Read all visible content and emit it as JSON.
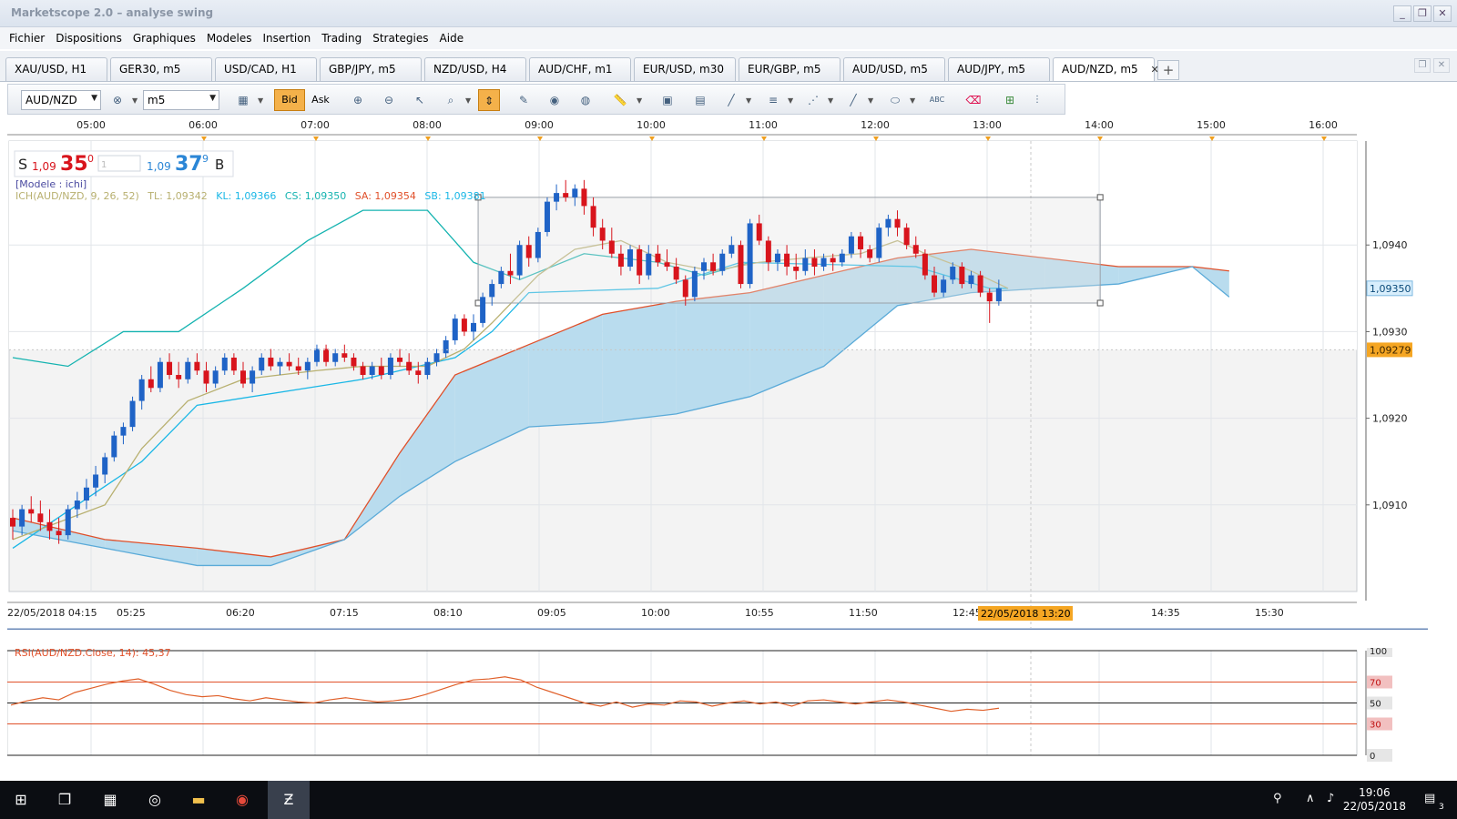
{
  "window": {
    "title": "Marketscope 2.0 – analyse swing",
    "btn_min": "_",
    "btn_max": "❐",
    "btn_close": "✕"
  },
  "menu": [
    "Fichier",
    "Dispositions",
    "Graphiques",
    "Modeles",
    "Insertion",
    "Trading",
    "Strategies",
    "Aide"
  ],
  "tabs": [
    {
      "label": "XAU/USD, H1"
    },
    {
      "label": "GER30, m5"
    },
    {
      "label": "USD/CAD, H1"
    },
    {
      "label": "GBP/JPY, m5"
    },
    {
      "label": "NZD/USD, H4"
    },
    {
      "label": "AUD/CHF, m1"
    },
    {
      "label": "EUR/USD, m30"
    },
    {
      "label": "EUR/GBP, m5"
    },
    {
      "label": "AUD/USD, m5"
    },
    {
      "label": "AUD/JPY, m5"
    },
    {
      "label": "AUD/NZD, m5",
      "active": true
    }
  ],
  "tab_close": "✕",
  "tab_add": "+",
  "toolbar": {
    "instrument": "AUD/NZD",
    "timeframe": "m5",
    "bid_label": "Bid",
    "ask_label": "Ask",
    "abc": "ABC"
  },
  "quote": {
    "sell_label": "S",
    "sell_big": "1,09",
    "sell_pips": "35",
    "sell_frac": "0",
    "lot": "1",
    "buy_big": "1,09",
    "buy_pips": "37",
    "buy_frac": "9",
    "buy_label": "B"
  },
  "chart_data": {
    "type": "candlestick",
    "instrument": "AUD/NZD",
    "timeframe": "m5",
    "template_label": "[Modele : ichi]",
    "legend": {
      "ich": "ICH(AUD/NZD, 9, 26, 52)",
      "tl": "TL: 1,09342",
      "kl": "KL: 1,09366",
      "cs": "CS: 1,09350",
      "sa": "SA: 1,09354",
      "sb": "SB: 1,09381"
    },
    "top_time_labels": [
      "05:00",
      "06:00",
      "07:00",
      "08:00",
      "09:00",
      "10:00",
      "11:00",
      "12:00",
      "13:00",
      "14:00",
      "15:00",
      "16:00"
    ],
    "bottom_time_labels": [
      "22/05/2018 04:15",
      "05:25",
      "06:20",
      "07:15",
      "08:10",
      "09:05",
      "10:00",
      "10:55",
      "11:50",
      "12:45",
      "14:35",
      "15:30"
    ],
    "cursor_date": "22/05/2018 13:20",
    "y_ticks": [
      "1,0940",
      "1,0930",
      "1,0920",
      "1,0910"
    ],
    "y_tick_values": [
      1.094,
      1.093,
      1.092,
      1.091
    ],
    "ylim": [
      1.09,
      1.0952
    ],
    "current_price_label": "1,09350",
    "current_price": 1.0935,
    "marker_price_label": "1,09279",
    "marker_price": 1.09279,
    "colors": {
      "up": "#1f63c6",
      "down": "#d8141c",
      "tenkan": "#b8b070",
      "kijun": "#1ab7e6",
      "chikou": "#15b3b0",
      "span_a": "#e0502a",
      "cloud_bull": "#b9dcee",
      "cloud_bear": "#f3cdbf"
    },
    "candles": [
      [
        1.09085,
        1.09095,
        1.0906,
        1.09075
      ],
      [
        1.09075,
        1.091,
        1.09065,
        1.09095
      ],
      [
        1.09095,
        1.0911,
        1.0908,
        1.0909
      ],
      [
        1.0909,
        1.09105,
        1.0907,
        1.0908
      ],
      [
        1.0908,
        1.09095,
        1.0906,
        1.0907
      ],
      [
        1.0907,
        1.09085,
        1.09055,
        1.09065
      ],
      [
        1.09065,
        1.091,
        1.0906,
        1.09095
      ],
      [
        1.09095,
        1.09115,
        1.09085,
        1.09105
      ],
      [
        1.09105,
        1.0913,
        1.09095,
        1.0912
      ],
      [
        1.0912,
        1.09145,
        1.0911,
        1.09135
      ],
      [
        1.09135,
        1.0916,
        1.09125,
        1.09155
      ],
      [
        1.09155,
        1.09185,
        1.0915,
        1.0918
      ],
      [
        1.0918,
        1.09195,
        1.0917,
        1.0919
      ],
      [
        1.0919,
        1.09225,
        1.09185,
        1.0922
      ],
      [
        1.0922,
        1.0925,
        1.0921,
        1.09245
      ],
      [
        1.09245,
        1.0926,
        1.0923,
        1.09235
      ],
      [
        1.09235,
        1.0927,
        1.0923,
        1.09265
      ],
      [
        1.09265,
        1.09275,
        1.09245,
        1.0925
      ],
      [
        1.0925,
        1.09265,
        1.09235,
        1.09245
      ],
      [
        1.09245,
        1.0927,
        1.0924,
        1.09265
      ],
      [
        1.09265,
        1.09275,
        1.0925,
        1.09255
      ],
      [
        1.09255,
        1.09265,
        1.0923,
        1.0924
      ],
      [
        1.0924,
        1.0926,
        1.09235,
        1.09255
      ],
      [
        1.09255,
        1.09275,
        1.0925,
        1.0927
      ],
      [
        1.0927,
        1.09275,
        1.0925,
        1.09255
      ],
      [
        1.09255,
        1.09265,
        1.09235,
        1.0924
      ],
      [
        1.0924,
        1.0926,
        1.0923,
        1.09255
      ],
      [
        1.09255,
        1.09275,
        1.0925,
        1.0927
      ],
      [
        1.0927,
        1.0928,
        1.09255,
        1.0926
      ],
      [
        1.0926,
        1.0927,
        1.0925,
        1.09265
      ],
      [
        1.09265,
        1.09275,
        1.09255,
        1.0926
      ],
      [
        1.0926,
        1.0927,
        1.0925,
        1.09255
      ],
      [
        1.09255,
        1.0927,
        1.09245,
        1.09265
      ],
      [
        1.09265,
        1.09285,
        1.0926,
        1.0928
      ],
      [
        1.0928,
        1.09285,
        1.0926,
        1.09265
      ],
      [
        1.09265,
        1.0928,
        1.0926,
        1.09275
      ],
      [
        1.09275,
        1.09285,
        1.09265,
        1.0927
      ],
      [
        1.0927,
        1.09275,
        1.09255,
        1.0926
      ],
      [
        1.0926,
        1.09265,
        1.09245,
        1.0925
      ],
      [
        1.0925,
        1.09265,
        1.09245,
        1.0926
      ],
      [
        1.0926,
        1.0927,
        1.09245,
        1.0925
      ],
      [
        1.0925,
        1.09275,
        1.09245,
        1.0927
      ],
      [
        1.0927,
        1.0928,
        1.0926,
        1.09265
      ],
      [
        1.09265,
        1.09275,
        1.0925,
        1.09255
      ],
      [
        1.09255,
        1.09265,
        1.0924,
        1.0925
      ],
      [
        1.0925,
        1.0927,
        1.09245,
        1.09265
      ],
      [
        1.09265,
        1.0928,
        1.0926,
        1.09275
      ],
      [
        1.09275,
        1.09295,
        1.0927,
        1.0929
      ],
      [
        1.0929,
        1.0932,
        1.09285,
        1.09315
      ],
      [
        1.09315,
        1.0932,
        1.09295,
        1.093
      ],
      [
        1.093,
        1.0932,
        1.0929,
        1.0931
      ],
      [
        1.0931,
        1.09345,
        1.09305,
        1.0934
      ],
      [
        1.0934,
        1.0936,
        1.0933,
        1.09355
      ],
      [
        1.09355,
        1.09375,
        1.0935,
        1.0937
      ],
      [
        1.0937,
        1.0939,
        1.09355,
        1.09365
      ],
      [
        1.09365,
        1.09405,
        1.0936,
        1.094
      ],
      [
        1.094,
        1.0941,
        1.09375,
        1.09385
      ],
      [
        1.09385,
        1.0942,
        1.0938,
        1.09415
      ],
      [
        1.09415,
        1.09455,
        1.0941,
        1.0945
      ],
      [
        1.0945,
        1.0947,
        1.0944,
        1.0946
      ],
      [
        1.0946,
        1.09475,
        1.0945,
        1.09455
      ],
      [
        1.09455,
        1.0947,
        1.09445,
        1.09465
      ],
      [
        1.09465,
        1.09475,
        1.09435,
        1.09445
      ],
      [
        1.09445,
        1.09455,
        1.0941,
        1.0942
      ],
      [
        1.0942,
        1.0943,
        1.09395,
        1.09405
      ],
      [
        1.09405,
        1.0942,
        1.09385,
        1.0939
      ],
      [
        1.0939,
        1.094,
        1.09365,
        1.09375
      ],
      [
        1.09375,
        1.094,
        1.0937,
        1.09395
      ],
      [
        1.09395,
        1.094,
        1.09355,
        1.09365
      ],
      [
        1.09365,
        1.094,
        1.0936,
        1.0939
      ],
      [
        1.0939,
        1.094,
        1.09375,
        1.0938
      ],
      [
        1.0938,
        1.09395,
        1.0937,
        1.09375
      ],
      [
        1.09375,
        1.09385,
        1.09355,
        1.0936
      ],
      [
        1.0936,
        1.09365,
        1.0933,
        1.0934
      ],
      [
        1.0934,
        1.09375,
        1.09335,
        1.0937
      ],
      [
        1.0937,
        1.09385,
        1.0936,
        1.0938
      ],
      [
        1.0938,
        1.0939,
        1.09365,
        1.0937
      ],
      [
        1.0937,
        1.09395,
        1.09365,
        1.0939
      ],
      [
        1.0939,
        1.0941,
        1.09385,
        1.094
      ],
      [
        1.094,
        1.09405,
        1.0935,
        1.09355
      ],
      [
        1.09355,
        1.0943,
        1.0935,
        1.09425
      ],
      [
        1.09425,
        1.09435,
        1.094,
        1.09405
      ],
      [
        1.09405,
        1.0941,
        1.0937,
        1.0938
      ],
      [
        1.0938,
        1.09395,
        1.0937,
        1.0939
      ],
      [
        1.0939,
        1.094,
        1.09365,
        1.09375
      ],
      [
        1.09375,
        1.0939,
        1.0936,
        1.0937
      ],
      [
        1.0937,
        1.09395,
        1.09365,
        1.09385
      ],
      [
        1.09385,
        1.09395,
        1.09365,
        1.09375
      ],
      [
        1.09375,
        1.0939,
        1.0937,
        1.09385
      ],
      [
        1.09385,
        1.0939,
        1.0937,
        1.0938
      ],
      [
        1.0938,
        1.09395,
        1.09375,
        1.0939
      ],
      [
        1.0939,
        1.09415,
        1.09385,
        1.0941
      ],
      [
        1.0941,
        1.09415,
        1.09385,
        1.09395
      ],
      [
        1.09395,
        1.094,
        1.0938,
        1.09385
      ],
      [
        1.09385,
        1.09425,
        1.0938,
        1.0942
      ],
      [
        1.0942,
        1.09435,
        1.0941,
        1.0943
      ],
      [
        1.0943,
        1.0944,
        1.0941,
        1.0942
      ],
      [
        1.0942,
        1.09425,
        1.09395,
        1.094
      ],
      [
        1.094,
        1.0941,
        1.09385,
        1.0939
      ],
      [
        1.0939,
        1.09395,
        1.0936,
        1.09365
      ],
      [
        1.09365,
        1.09375,
        1.0934,
        1.09345
      ],
      [
        1.09345,
        1.09365,
        1.0934,
        1.0936
      ],
      [
        1.0936,
        1.0938,
        1.09355,
        1.09375
      ],
      [
        1.09375,
        1.0938,
        1.0935,
        1.09355
      ],
      [
        1.09355,
        1.0937,
        1.0935,
        1.09365
      ],
      [
        1.09365,
        1.0937,
        1.0934,
        1.09345
      ],
      [
        1.09345,
        1.0935,
        1.0931,
        1.09335
      ],
      [
        1.09335,
        1.0936,
        1.0933,
        1.0935
      ]
    ],
    "tenkan": [
      [
        0,
        1.0906
      ],
      [
        10,
        1.091
      ],
      [
        14,
        1.09165
      ],
      [
        19,
        1.0922
      ],
      [
        25,
        1.09245
      ],
      [
        33,
        1.09255
      ],
      [
        38,
        1.0926
      ],
      [
        45,
        1.0926
      ],
      [
        49,
        1.0928
      ],
      [
        52,
        1.0931
      ],
      [
        57,
        1.09365
      ],
      [
        61,
        1.09395
      ],
      [
        66,
        1.09405
      ],
      [
        71,
        1.0938
      ],
      [
        76,
        1.0937
      ],
      [
        81,
        1.0938
      ],
      [
        86,
        1.09385
      ],
      [
        92,
        1.0939
      ],
      [
        96,
        1.09405
      ],
      [
        99,
        1.0939
      ],
      [
        104,
        1.0937
      ],
      [
        108,
        1.0935
      ]
    ],
    "kijun": [
      [
        0,
        1.0905
      ],
      [
        14,
        1.0915
      ],
      [
        20,
        1.09215
      ],
      [
        38,
        1.09245
      ],
      [
        48,
        1.0927
      ],
      [
        52,
        1.093
      ],
      [
        56,
        1.09345
      ],
      [
        70,
        1.0935
      ],
      [
        79,
        1.0938
      ],
      [
        98,
        1.09375
      ],
      [
        106,
        1.0935
      ],
      [
        108,
        1.0935
      ]
    ],
    "chikou": [
      [
        0,
        1.0927
      ],
      [
        6,
        1.0926
      ],
      [
        12,
        1.093
      ],
      [
        18,
        1.093
      ],
      [
        25,
        1.0935
      ],
      [
        32,
        1.09405
      ],
      [
        38,
        1.0944
      ],
      [
        45,
        1.0944
      ],
      [
        50,
        1.0938
      ],
      [
        55,
        1.0936
      ],
      [
        62,
        1.0939
      ],
      [
        70,
        1.0938
      ],
      [
        75,
        1.09365
      ],
      [
        80,
        1.0938
      ]
    ],
    "span_a": [
      [
        0,
        1.09085
      ],
      [
        10,
        1.0906
      ],
      [
        20,
        1.0905
      ],
      [
        28,
        1.0904
      ],
      [
        36,
        1.0906
      ],
      [
        42,
        1.0916
      ],
      [
        48,
        1.0925
      ],
      [
        56,
        1.09285
      ],
      [
        64,
        1.0932
      ],
      [
        72,
        1.09335
      ],
      [
        80,
        1.09345
      ],
      [
        88,
        1.09365
      ],
      [
        96,
        1.09385
      ],
      [
        104,
        1.09395
      ],
      [
        112,
        1.09385
      ],
      [
        120,
        1.09375
      ],
      [
        128,
        1.09375
      ],
      [
        132,
        1.0937
      ]
    ],
    "span_b": [
      [
        0,
        1.0907
      ],
      [
        10,
        1.0905
      ],
      [
        20,
        1.0903
      ],
      [
        28,
        1.0903
      ],
      [
        36,
        1.0906
      ],
      [
        42,
        1.0911
      ],
      [
        48,
        1.0915
      ],
      [
        56,
        1.0919
      ],
      [
        64,
        1.09195
      ],
      [
        72,
        1.09205
      ],
      [
        80,
        1.09225
      ],
      [
        88,
        1.0926
      ],
      [
        96,
        1.0933
      ],
      [
        104,
        1.09345
      ],
      [
        112,
        1.0935
      ],
      [
        120,
        1.09355
      ],
      [
        128,
        1.09375
      ],
      [
        132,
        1.0934
      ]
    ],
    "rsi": {
      "label": "RSI(AUD/NZD.Close, 14): 45,37",
      "levels": [
        "100",
        "70",
        "50",
        "30",
        "0"
      ],
      "level_values": [
        100,
        70,
        50,
        30,
        0
      ],
      "values": [
        48,
        52,
        55,
        53,
        60,
        64,
        68,
        71,
        73,
        68,
        62,
        58,
        56,
        57,
        54,
        52,
        55,
        53,
        51,
        50,
        53,
        55,
        53,
        51,
        52,
        54,
        58,
        63,
        68,
        72,
        73,
        75,
        72,
        65,
        60,
        55,
        50,
        47,
        51,
        46,
        49,
        48,
        52,
        51,
        47,
        50,
        52,
        49,
        51,
        47,
        52,
        53,
        51,
        49,
        51,
        53,
        51,
        48,
        45,
        42,
        44,
        43,
        45
      ]
    }
  },
  "taskbar": {
    "time": "19:06",
    "date": "22/05/2018",
    "notif": "3"
  }
}
